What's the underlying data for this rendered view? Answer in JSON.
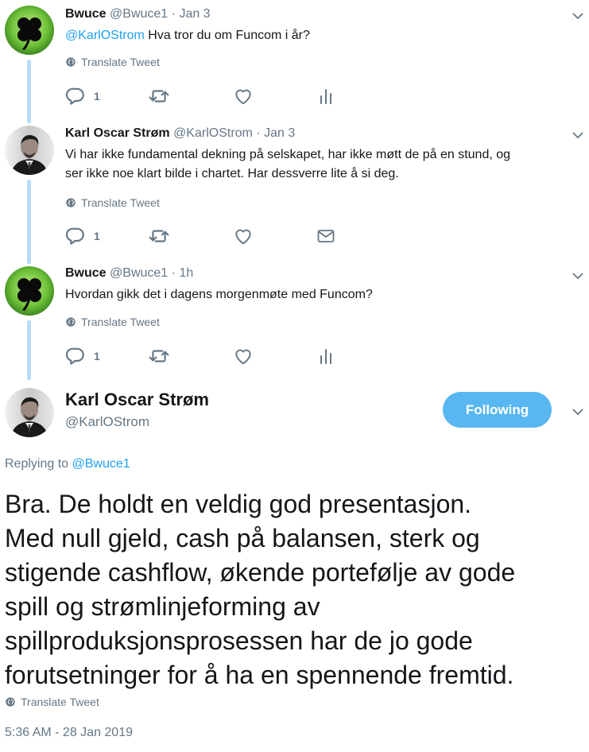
{
  "tweets": [
    {
      "name": "Bwuce",
      "handle": "@Bwuce1",
      "sep": "·",
      "time": "Jan 3",
      "mention": "@KarlOStrom",
      "text": " Hva tror du om Funcom i år?",
      "translate": "Translate Tweet",
      "reply_count": "1"
    },
    {
      "name": "Karl Oscar Strøm",
      "handle": "@KarlOStrom",
      "sep": "·",
      "time": "Jan 3",
      "text_line1": "Vi har ikke fundamental dekning på selskapet, har ikke møtt de på en stund, og",
      "text_line2": "ser ikke noe klart bilde i chartet. Har dessverre lite å si deg.",
      "translate": "Translate Tweet",
      "reply_count": "1"
    },
    {
      "name": "Bwuce",
      "handle": "@Bwuce1",
      "sep": "·",
      "time": "1h",
      "text": "Hvordan gikk det i dagens morgenmøte med Funcom?",
      "translate": "Translate Tweet",
      "reply_count": "1"
    }
  ],
  "main_tweet": {
    "name": "Karl Oscar Strøm",
    "handle": "@KarlOStrom",
    "follow_label": "Following",
    "replying_prefix": "Replying to ",
    "replying_to": "@Bwuce1",
    "lines": [
      "Bra. De holdt en veldig god presentasjon.",
      "Med null gjeld, cash på balansen, sterk og",
      "stigende cashflow, økende portefølje av gode",
      "spill og strømlinjeforming av",
      "spillproduksjonsprosessen har de jo gode",
      "forutsetninger for å ha en spennende fremtid."
    ],
    "translate": "Translate Tweet",
    "timestamp": "5:36 AM - 28 Jan 2019"
  },
  "icons": {
    "reply": "reply-icon",
    "retweet": "retweet-icon",
    "like": "heart-icon",
    "analytics": "analytics-icon",
    "dm": "envelope-icon",
    "globe": "globe-icon",
    "caret": "chevron-down-icon"
  },
  "colors": {
    "accent": "#1da1f2",
    "follow_button": "#58b7f0",
    "secondary_text": "#657786",
    "thread_line": "#b8dcf6"
  }
}
